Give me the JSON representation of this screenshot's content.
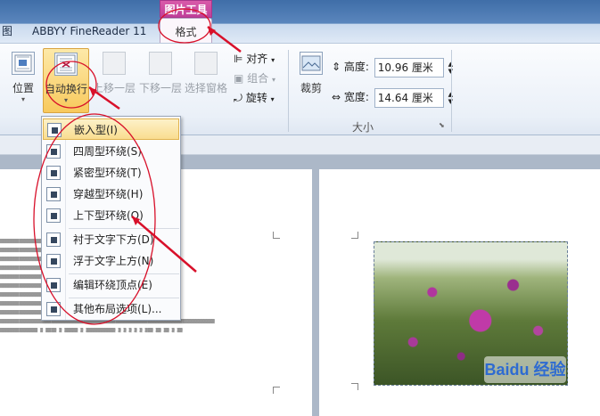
{
  "tabs": {
    "cut": "图",
    "abbyy": "ABBYY FineReader 11",
    "context_header": "图片工具",
    "format": "格式"
  },
  "ribbon": {
    "position": "位置",
    "wrap_text": "自动换行",
    "bring_forward": "上移一层",
    "send_backward": "下移一层",
    "selection_pane": "选择窗格",
    "align": "对齐",
    "group": "组合",
    "rotate": "旋转",
    "crop": "裁剪",
    "height_label": "高度:",
    "height_value": "10.96 厘米",
    "width_label": "宽度:",
    "width_value": "14.64 厘米",
    "size_group": "大小"
  },
  "menu": {
    "items": [
      {
        "label": "嵌入型(I)"
      },
      {
        "label": "四周型环绕(S)"
      },
      {
        "label": "紧密型环绕(T)"
      },
      {
        "label": "穿越型环绕(H)"
      },
      {
        "label": "上下型环绕(O)"
      },
      {
        "label": "衬于文字下方(D)"
      },
      {
        "label": "浮于文字上方(N)"
      },
      {
        "label": "编辑环绕顶点(E)"
      },
      {
        "label": "其他布局选项(L)..."
      }
    ]
  },
  "watermark": "Baidu 经验",
  "colors": {
    "context_tab": "#c0409a",
    "annotation": "#d8102a",
    "selected_button": "#f8c95c"
  }
}
